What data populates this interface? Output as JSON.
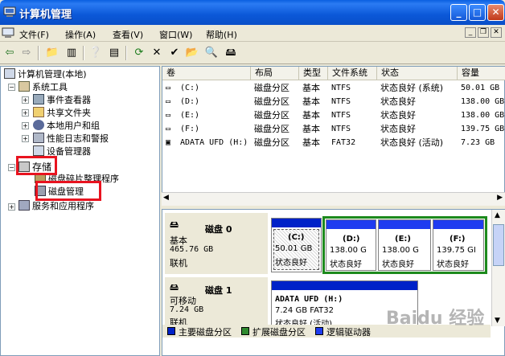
{
  "window": {
    "title": "计算机管理"
  },
  "menu": [
    "文件(F)",
    "操作(A)",
    "查看(V)",
    "窗口(W)",
    "帮助(H)"
  ],
  "tree": {
    "root": "计算机管理(本地)",
    "system_tools": "系统工具",
    "event_viewer": "事件查看器",
    "shared_folders": "共享文件夹",
    "local_users": "本地用户和组",
    "perf_logs": "性能日志和警报",
    "device_manager": "设备管理器",
    "storage": "存储",
    "defrag": "磁盘碎片整理程序",
    "disk_mgmt": "磁盘管理",
    "services": "服务和应用程序"
  },
  "table": {
    "headers": [
      "卷",
      "布局",
      "类型",
      "文件系统",
      "状态",
      "容量"
    ],
    "rows": [
      [
        "(C:)",
        "磁盘分区",
        "基本",
        "NTFS",
        "状态良好 (系统)",
        "50.01 GB"
      ],
      [
        "(D:)",
        "磁盘分区",
        "基本",
        "NTFS",
        "状态良好",
        "138.00 GB"
      ],
      [
        "(E:)",
        "磁盘分区",
        "基本",
        "NTFS",
        "状态良好",
        "138.00 GB"
      ],
      [
        "(F:)",
        "磁盘分区",
        "基本",
        "NTFS",
        "状态良好",
        "139.75 GB"
      ],
      [
        "ADATA UFD (H:)",
        "磁盘分区",
        "基本",
        "FAT32",
        "状态良好 (活动)",
        "7.23 GB"
      ]
    ]
  },
  "disks": [
    {
      "name": "磁盘 0",
      "type": "基本",
      "size": "465.76 GB",
      "status": "联机",
      "partitions": [
        {
          "label": "(C:)",
          "size": "50.01 GB",
          "status": "状态良好"
        },
        {
          "label": "(D:)",
          "size": "138.00 G",
          "status": "状态良好"
        },
        {
          "label": "(E:)",
          "size": "138.00 G",
          "status": "状态良好"
        },
        {
          "label": "(F:)",
          "size": "139.75 GI",
          "status": "状态良好"
        }
      ]
    },
    {
      "name": "磁盘 1",
      "type": "可移动",
      "size": "7.24 GB",
      "status": "联机",
      "partitions": [
        {
          "label": "ADATA UFD  (H:)",
          "size": "7.24 GB FAT32",
          "status": "状态良好 (活动)"
        }
      ]
    }
  ],
  "legend": [
    {
      "label": "主要磁盘分区",
      "color": "#0022c8"
    },
    {
      "label": "扩展磁盘分区",
      "color": "#2f8a2f"
    },
    {
      "label": "逻辑驱动器",
      "color": "#1e3cf0"
    }
  ],
  "watermark": "Baidu 经验",
  "colors": {
    "primary": "#0022c8",
    "extended": "#1d8a1d",
    "selection_red": "#e8131f"
  }
}
